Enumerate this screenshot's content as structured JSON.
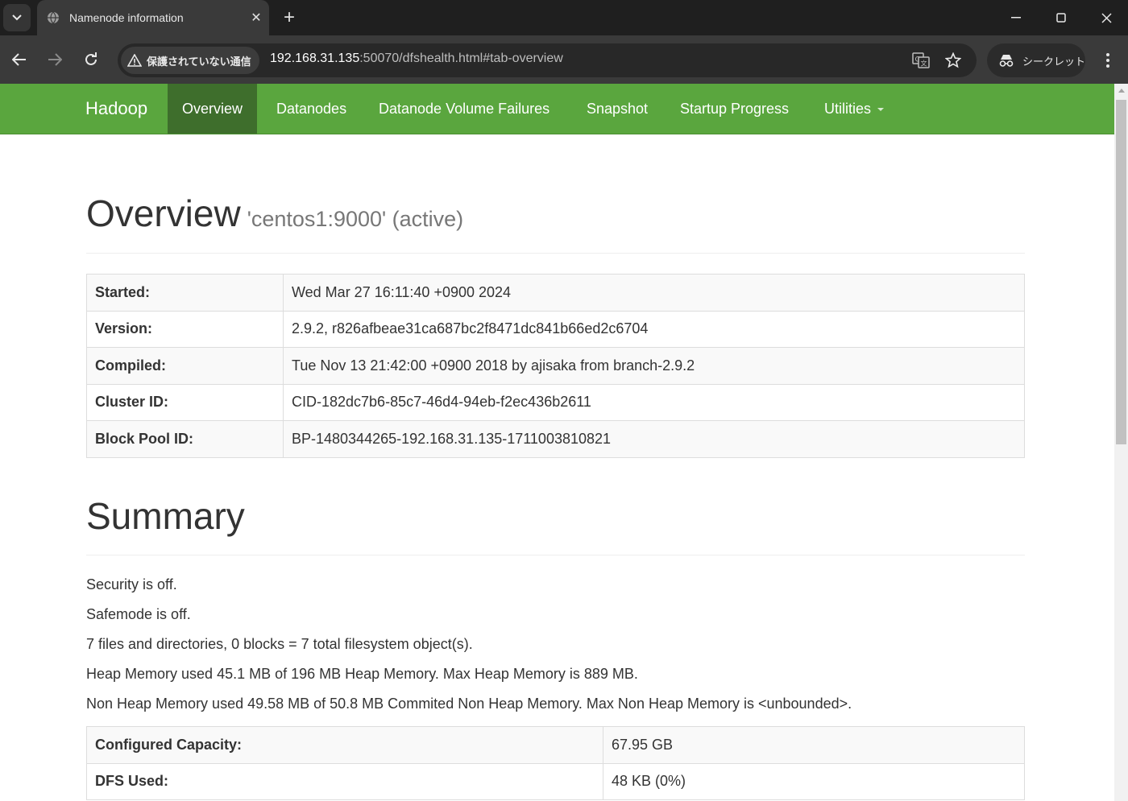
{
  "browser": {
    "tab_title": "Namenode information",
    "security_label": "保護されていない通信",
    "url_host": "192.168.31.135",
    "url_path": ":50070/dfshealth.html#tab-overview",
    "incognito_label": "シークレット"
  },
  "navbar": {
    "brand": "Hadoop",
    "items": [
      {
        "label": "Overview",
        "active": true
      },
      {
        "label": "Datanodes"
      },
      {
        "label": "Datanode Volume Failures"
      },
      {
        "label": "Snapshot"
      },
      {
        "label": "Startup Progress"
      },
      {
        "label": "Utilities"
      }
    ]
  },
  "overview": {
    "title": "Overview",
    "subtitle": "'centos1:9000' (active)",
    "rows": [
      {
        "key": "Started:",
        "value": "Wed Mar 27 16:11:40 +0900 2024"
      },
      {
        "key": "Version:",
        "value": "2.9.2, r826afbeae31ca687bc2f8471dc841b66ed2c6704"
      },
      {
        "key": "Compiled:",
        "value": "Tue Nov 13 21:42:00 +0900 2018 by ajisaka from branch-2.9.2"
      },
      {
        "key": "Cluster ID:",
        "value": "CID-182dc7b6-85c7-46d4-94eb-f2ec436b2611"
      },
      {
        "key": "Block Pool ID:",
        "value": "BP-1480344265-192.168.31.135-1711003810821"
      }
    ]
  },
  "summary": {
    "title": "Summary",
    "lines": [
      "Security is off.",
      "Safemode is off.",
      "7 files and directories, 0 blocks = 7 total filesystem object(s).",
      "Heap Memory used 45.1 MB of 196 MB Heap Memory. Max Heap Memory is 889 MB.",
      "Non Heap Memory used 49.58 MB of 50.8 MB Commited Non Heap Memory. Max Non Heap Memory is <unbounded>."
    ],
    "rows": [
      {
        "key": "Configured Capacity:",
        "value": "67.95 GB"
      },
      {
        "key": "DFS Used:",
        "value": "48 KB (0%)"
      }
    ]
  }
}
